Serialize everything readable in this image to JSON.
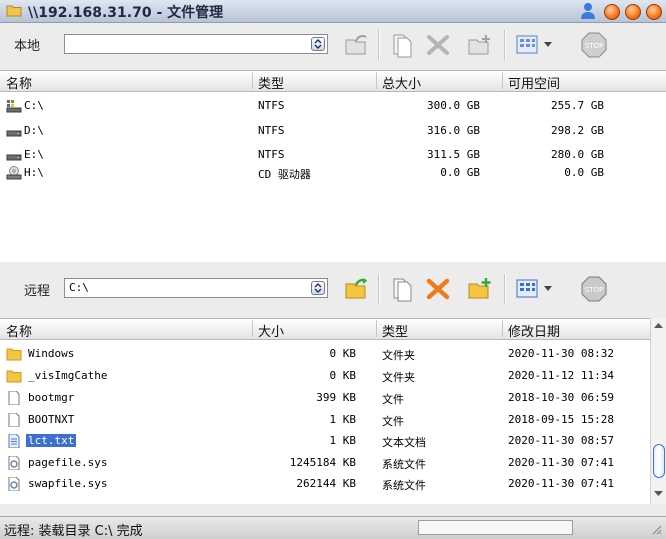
{
  "window": {
    "title": "\\\\192.168.31.70 - 文件管理"
  },
  "local": {
    "label": "本地",
    "path": "",
    "columns": [
      "名称",
      "类型",
      "总大小",
      "可用空间"
    ],
    "rows": [
      {
        "name": "C:\\",
        "type": "NTFS",
        "total": "300.0 GB",
        "free": "255.7 GB",
        "icon": "drive-system-icon"
      },
      {
        "name": "D:\\",
        "type": "NTFS",
        "total": "316.0 GB",
        "free": "298.2 GB",
        "icon": "drive-icon"
      },
      {
        "name": "E:\\",
        "type": "NTFS",
        "total": "311.5 GB",
        "free": "280.0 GB",
        "icon": "drive-icon"
      },
      {
        "name": "H:\\",
        "type": "CD 驱动器",
        "total": "0.0 GB",
        "free": "0.0 GB",
        "icon": "cd-drive-icon"
      }
    ]
  },
  "remote": {
    "label": "远程",
    "path": "C:\\",
    "columns": [
      "名称",
      "大小",
      "类型",
      "修改日期"
    ],
    "rows": [
      {
        "name": "Windows",
        "size": "0 KB",
        "type": "文件夹",
        "date": "2020-11-30 08:32",
        "icon": "folder-icon"
      },
      {
        "name": "_visImgCathe",
        "size": "0 KB",
        "type": "文件夹",
        "date": "2020-11-12 11:34",
        "icon": "folder-icon"
      },
      {
        "name": "bootmgr",
        "size": "399 KB",
        "type": "文件",
        "date": "2018-10-30 06:59",
        "icon": "file-icon"
      },
      {
        "name": "BOOTNXT",
        "size": "1 KB",
        "type": "文件",
        "date": "2018-09-15 15:28",
        "icon": "file-icon"
      },
      {
        "name": "lct.txt",
        "size": "1 KB",
        "type": "文本文档",
        "date": "2020-11-30 08:57",
        "icon": "text-file-icon",
        "selected": true
      },
      {
        "name": "pagefile.sys",
        "size": "1245184 KB",
        "type": "系统文件",
        "date": "2020-11-30 07:41",
        "icon": "system-file-icon"
      },
      {
        "name": "swapfile.sys",
        "size": "262144 KB",
        "type": "系统文件",
        "date": "2020-11-30 07:41",
        "icon": "system-file-icon"
      }
    ]
  },
  "status": {
    "text": "远程: 装载目录 C:\\ 完成"
  },
  "colors": {
    "accent": "#3d6fce",
    "title_buttons": "#ff7a1a",
    "folder": "#f5c542",
    "delete_active": "#f07a18"
  }
}
